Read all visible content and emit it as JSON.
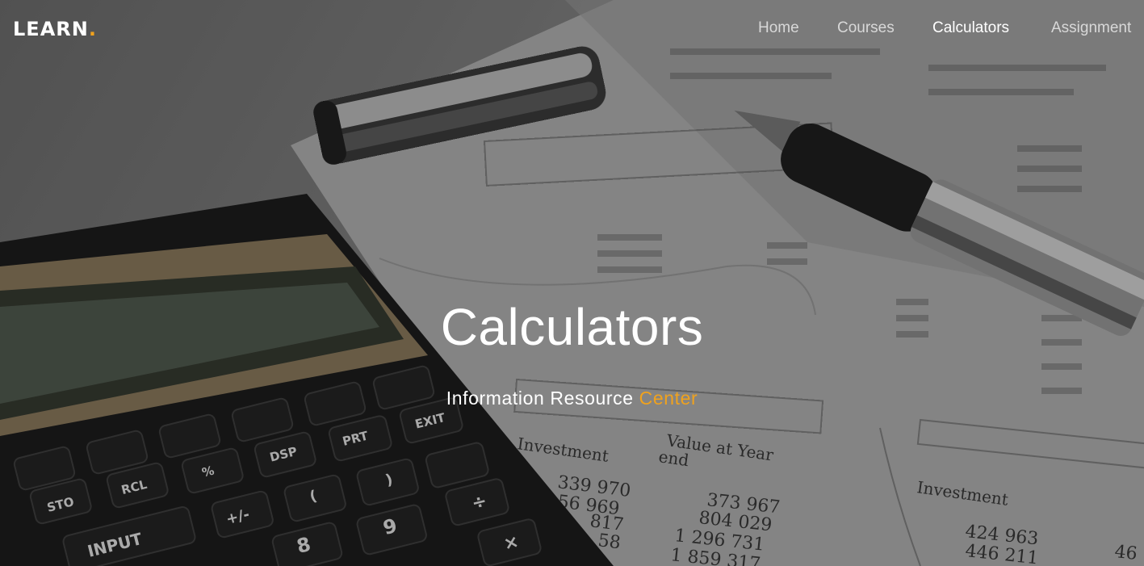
{
  "brand": {
    "name": "LEARN",
    "dot": ".",
    "accent_color": "#f0a21d"
  },
  "nav": {
    "items": [
      {
        "label": "Home",
        "active": false
      },
      {
        "label": "Courses",
        "active": false
      },
      {
        "label": "Calculators",
        "active": true
      },
      {
        "label": "Assignment",
        "active": false
      }
    ]
  },
  "hero": {
    "title": "Calculators",
    "subtitle_main": "Information Resource",
    "subtitle_accent": "Center",
    "background": "calculator-pen-financial-report-photo"
  },
  "calculator_keys": [
    "STO",
    "RCL",
    "%",
    "DSP",
    "PRT",
    "EXIT",
    "INPUT",
    "+/-",
    "(",
    ")",
    "÷",
    "8",
    "9",
    "×"
  ],
  "report": {
    "headings": [
      "Investment",
      "Value at Year",
      "end",
      "Investment"
    ],
    "figures": [
      "339 970",
      "56 969",
      "817",
      "58",
      "373 967",
      "804 029",
      "1 296 731",
      "1 859 317",
      "424 963",
      "446 211",
      "46"
    ]
  }
}
